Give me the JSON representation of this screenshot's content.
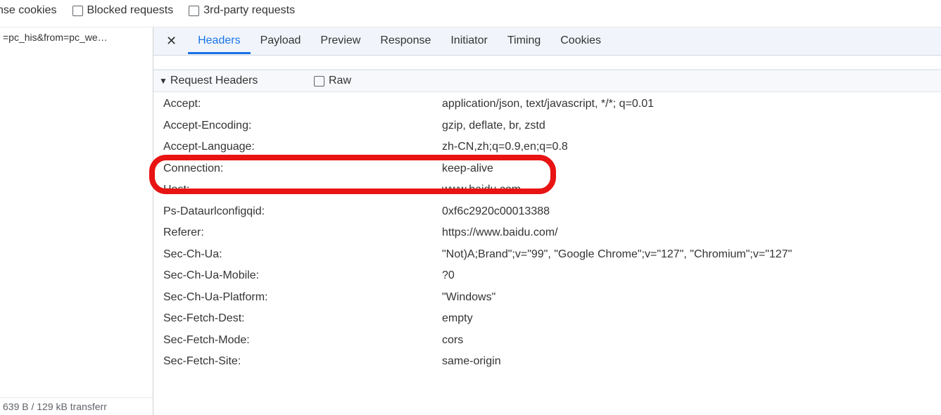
{
  "filters": {
    "response_cookies": "nse cookies",
    "blocked": "Blocked requests",
    "third_party": "3rd-party requests"
  },
  "left": {
    "request_item": "=pc_his&from=pc_we…",
    "status_text": "639 B / 129 kB transferr"
  },
  "tabs": {
    "items": [
      "Headers",
      "Payload",
      "Preview",
      "Response",
      "Initiator",
      "Timing",
      "Cookies"
    ]
  },
  "cutoff": {
    "name": "",
    "value": ""
  },
  "section": {
    "title": "Request Headers",
    "raw_label": "Raw"
  },
  "headers": [
    {
      "name": "Accept:",
      "value": "application/json, text/javascript, */*; q=0.01"
    },
    {
      "name": "Accept-Encoding:",
      "value": "gzip, deflate, br, zstd"
    },
    {
      "name": "Accept-Language:",
      "value": "zh-CN,zh;q=0.9,en;q=0.8"
    },
    {
      "name": "Connection:",
      "value": "keep-alive"
    },
    {
      "name": "Host:",
      "value": "www.baidu.com"
    },
    {
      "name": "Ps-Dataurlconfigqid:",
      "value": "0xf6c2920c00013388"
    },
    {
      "name": "Referer:",
      "value": "https://www.baidu.com/"
    },
    {
      "name": "Sec-Ch-Ua:",
      "value": "\"Not)A;Brand\";v=\"99\", \"Google Chrome\";v=\"127\", \"Chromium\";v=\"127\""
    },
    {
      "name": "Sec-Ch-Ua-Mobile:",
      "value": "?0"
    },
    {
      "name": "Sec-Ch-Ua-Platform:",
      "value": "\"Windows\""
    },
    {
      "name": "Sec-Fetch-Dest:",
      "value": "empty"
    },
    {
      "name": "Sec-Fetch-Mode:",
      "value": "cors"
    },
    {
      "name": "Sec-Fetch-Site:",
      "value": "same-origin"
    }
  ]
}
